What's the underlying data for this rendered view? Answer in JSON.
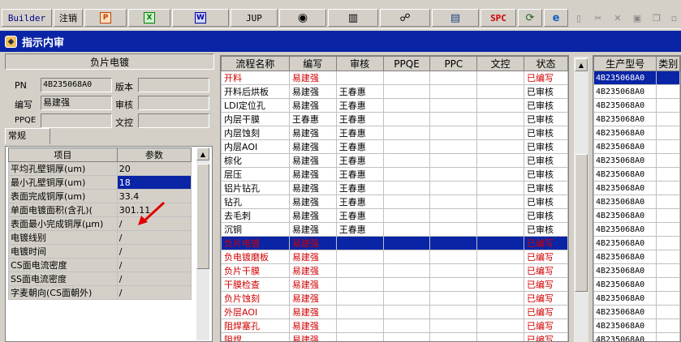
{
  "toolbar": {
    "builder": "Builder",
    "logout": "注销",
    "jup": "JUP",
    "spc": "SPC",
    "icons": [
      "ppt-icon",
      "excel-icon",
      "word-icon",
      "eye-icon",
      "database-icon",
      "network-icon",
      "printer-icon",
      "refresh-icon",
      "ie-icon",
      "new-doc-icon",
      "cut-icon",
      "delete-icon",
      "save-icon",
      "copy-icon"
    ]
  },
  "window": {
    "title": "指示内审"
  },
  "process": {
    "name": "负片电镀",
    "pn_label": "PN",
    "pn_value": "4B235068A0",
    "version_label": "版本",
    "version_value": "",
    "author_label": "编写",
    "author_value": "易建强",
    "reviewer_label": "审核",
    "reviewer_value": "",
    "ppqe_label": "PPQE",
    "ppqe_value": "",
    "doc_control_label": "文控",
    "doc_control_value": "",
    "tab_label": "常规"
  },
  "params": {
    "headers": [
      "项目",
      "参数"
    ],
    "rows": [
      [
        "平均孔壁铜厚(um)",
        "20"
      ],
      [
        "最小孔壁铜厚(um)",
        "18"
      ],
      [
        "表面完成铜厚(um)",
        "33.4"
      ],
      [
        "单面电镀面积(含孔)(",
        "301.11"
      ],
      [
        "表面最小完成铜厚(μm)",
        "/"
      ],
      [
        "电镀线别",
        "/"
      ],
      [
        "电镀时间",
        "/"
      ],
      [
        "CS面电流密度",
        "/"
      ],
      [
        "SS面电流密度",
        "/"
      ],
      [
        "字麦朝向(CS面朝外)",
        "/"
      ]
    ]
  },
  "flow": {
    "headers": [
      "流程名称",
      "编写",
      "审核",
      "PPQE",
      "PPC",
      "文控",
      "状态"
    ],
    "rows": [
      [
        "开料",
        "易建强",
        "",
        "",
        "",
        "",
        "已编写"
      ],
      [
        "开料后烘板",
        "易建强",
        "王春惠",
        "",
        "",
        "",
        "已审核"
      ],
      [
        "LDI定位孔",
        "易建强",
        "王春惠",
        "",
        "",
        "",
        "已审核"
      ],
      [
        "内层干膜",
        "王春惠",
        "王春惠",
        "",
        "",
        "",
        "已审核"
      ],
      [
        "内层蚀刻",
        "易建强",
        "王春惠",
        "",
        "",
        "",
        "已审核"
      ],
      [
        "内层AOI",
        "易建强",
        "王春惠",
        "",
        "",
        "",
        "已审核"
      ],
      [
        "棕化",
        "易建强",
        "王春惠",
        "",
        "",
        "",
        "已审核"
      ],
      [
        "层压",
        "易建强",
        "王春惠",
        "",
        "",
        "",
        "已审核"
      ],
      [
        "铝片钻孔",
        "易建强",
        "王春惠",
        "",
        "",
        "",
        "已审核"
      ],
      [
        "钻孔",
        "易建强",
        "王春惠",
        "",
        "",
        "",
        "已审核"
      ],
      [
        "去毛刺",
        "易建强",
        "王春惠",
        "",
        "",
        "",
        "已审核"
      ],
      [
        "沉铜",
        "易建强",
        "王春惠",
        "",
        "",
        "",
        "已审核"
      ],
      [
        "负片电镀",
        "易建强",
        "",
        "",
        "",
        "",
        "已编写"
      ],
      [
        "负电镀磨板",
        "易建强",
        "",
        "",
        "",
        "",
        "已编写"
      ],
      [
        "负片干膜",
        "易建强",
        "",
        "",
        "",
        "",
        "已编写"
      ],
      [
        "干膜检查",
        "易建强",
        "",
        "",
        "",
        "",
        "已编写"
      ],
      [
        "负片蚀刻",
        "易建强",
        "",
        "",
        "",
        "",
        "已编写"
      ],
      [
        "外层AOI",
        "易建强",
        "",
        "",
        "",
        "",
        "已编写"
      ],
      [
        "阻焊塞孔",
        "易建强",
        "",
        "",
        "",
        "",
        "已编写"
      ],
      [
        "阻焊",
        "易建强",
        "",
        "",
        "",
        "",
        "已编写"
      ]
    ]
  },
  "right": {
    "headers": [
      "生产型号",
      "类别"
    ],
    "rows": [
      "4B235068A0",
      "4B235068A0",
      "4B235068A0",
      "4B235068A0",
      "4B235068A0",
      "4B235068A0",
      "4B235068A0",
      "4B235068A0",
      "4B235068A0",
      "4B235068A0",
      "4B235068A0",
      "4B235068A0",
      "4B235068A0",
      "4B235068A0",
      "4B235068A0",
      "4B235068A0",
      "4B235068A0",
      "4B235068A0",
      "4B235068A0",
      "4B235068A0"
    ]
  },
  "colors": {
    "title_bg": "#0a24a6",
    "select": "#0a24a6",
    "red_text": "#d00000",
    "arrow": "#e00000"
  }
}
